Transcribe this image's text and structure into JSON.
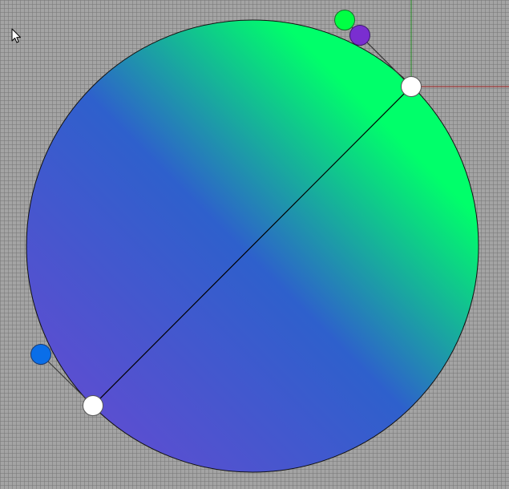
{
  "canvas": {
    "background": "#a4a4a4",
    "grid_color": "#787878",
    "axis_x_color": "#a02020",
    "axis_y_color": "#1f8a1f"
  },
  "gradient_circle": {
    "start_color": "#5a4fd0",
    "middle_color": "#2e60cc",
    "end_color": "#00ff6a",
    "outline_color": "#111111"
  },
  "gradient_line": {
    "color": "#000000"
  },
  "handles": {
    "endpoint_fill": "#ffffff",
    "endpoint_stroke": "#555555",
    "start_color_swatch": "#0a6ee8",
    "end_color_swatch": "#00ff44",
    "middle_color_swatch": "#7a2ed0"
  },
  "cursor": {
    "icon": "arrow-cursor-icon"
  }
}
